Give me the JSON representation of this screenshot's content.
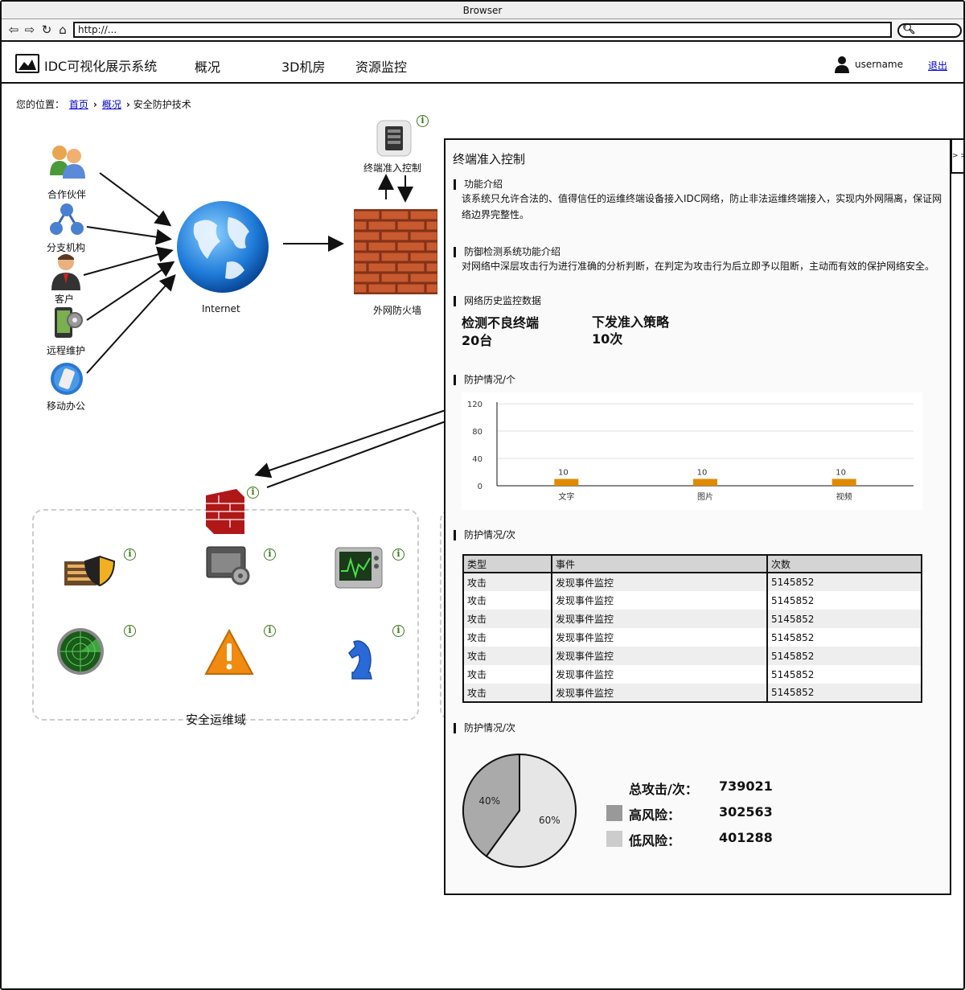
{
  "browser": {
    "title": "Browser",
    "url": "http://..."
  },
  "app": {
    "title": "IDC可视化展示系统",
    "nav": [
      "概况",
      "3D机房",
      "资源监控"
    ],
    "username": "username",
    "logout": "退出"
  },
  "breadcrumb": {
    "prefix": "您的位置：",
    "items": [
      "首页",
      "概况"
    ],
    "current": "安全防护技术"
  },
  "diagram": {
    "sources": [
      "合作伙伴",
      "分支机构",
      "客户",
      "远程维护",
      "移动办公"
    ],
    "internet": "Internet",
    "firewall": "外网防火墙",
    "terminal": "终端准入控制",
    "domain": "安全运维域"
  },
  "panel": {
    "collapse": "> >",
    "title": "终端准入控制",
    "sections": {
      "feature_title": "功能介绍",
      "feature_text": "该系统只允许合法的、值得信任的运维终端设备接入IDC网络，防止非法运维终端接入，实现内外网隔离，保证网络边界完整性。",
      "defense_title": "防御检测系统功能介绍",
      "defense_text": "对网络中深层攻击行为进行准确的分析判断，在判定为攻击行为后立即予以阻断，主动而有效的保护网络安全。",
      "history_title": "网络历史监控数据",
      "stat1_label": "检测不良终端",
      "stat1_value": "20台",
      "stat2_label": "下发准入策略",
      "stat2_value": "10次",
      "chart_title": "防护情况/个",
      "table_title": "防护情况/次",
      "pie_title": "防护情况/次"
    },
    "table": {
      "headers": [
        "类型",
        "事件",
        "次数"
      ],
      "rows": [
        [
          "攻击",
          "发现事件监控",
          "5145852"
        ],
        [
          "攻击",
          "发现事件监控",
          "5145852"
        ],
        [
          "攻击",
          "发现事件监控",
          "5145852"
        ],
        [
          "攻击",
          "发现事件监控",
          "5145852"
        ],
        [
          "攻击",
          "发现事件监控",
          "5145852"
        ],
        [
          "攻击",
          "发现事件监控",
          "5145852"
        ],
        [
          "攻击",
          "发现事件监控",
          "5145852"
        ]
      ]
    },
    "totals": {
      "total_label": "总攻击/次：",
      "total_value": "739021",
      "high_label": "高风险：",
      "high_value": "302563",
      "low_label": "低风险：",
      "low_value": "401288",
      "high_color": "#999999",
      "low_color": "#cccccc"
    }
  },
  "chart_data": [
    {
      "type": "bar",
      "categories": [
        "文字",
        "图片",
        "视频"
      ],
      "values": [
        10,
        10,
        10
      ],
      "yticks": [
        0,
        40,
        80,
        120
      ],
      "ylim": [
        0,
        120
      ],
      "grid": true,
      "bar_color": "#e08a00"
    },
    {
      "type": "pie",
      "labels": [
        "40%",
        "60%"
      ],
      "values": [
        40,
        60
      ],
      "colors": [
        "#aaaaaa",
        "#e6e6e6"
      ]
    }
  ]
}
